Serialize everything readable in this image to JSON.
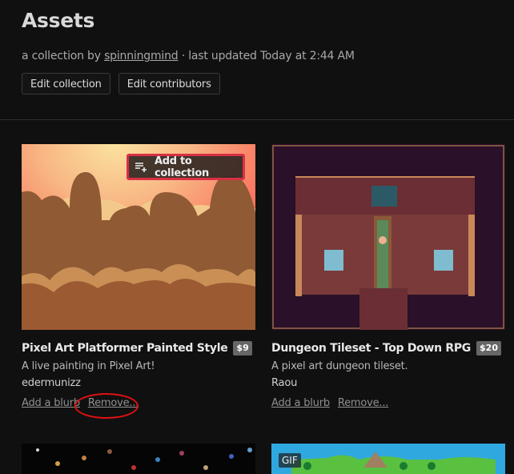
{
  "header": {
    "title": "Assets",
    "subtitle_prefix": "a collection by ",
    "author_link": "spinningmind",
    "subtitle_suffix": " · last updated Today at 2:44 AM",
    "buttons": [
      "Edit collection",
      "Edit contributors"
    ]
  },
  "games": [
    {
      "title": "Pixel Art Platformer Painted Style",
      "price": "$9",
      "description": "A live painting in Pixel Art!",
      "author": "edermunizz",
      "add_blurb": "Add a blurb",
      "remove": "Remove...",
      "overlay_button": "Add to collection"
    },
    {
      "title": "Dungeon Tileset - Top Down RPG",
      "price": "$20",
      "description": "A pixel art dungeon tileset.",
      "author": "Raou",
      "add_blurb": "Add a blurb",
      "remove": "Remove..."
    },
    {
      "title": "",
      "thumbnail": "pixel items on black"
    },
    {
      "title": "",
      "badge": "GIF",
      "thumbnail": "overworld map"
    }
  ],
  "colors": {
    "background": "#101010",
    "highlight_border": "#d83045",
    "annotation_circle": "#e01010",
    "price_badge": "#666666"
  }
}
